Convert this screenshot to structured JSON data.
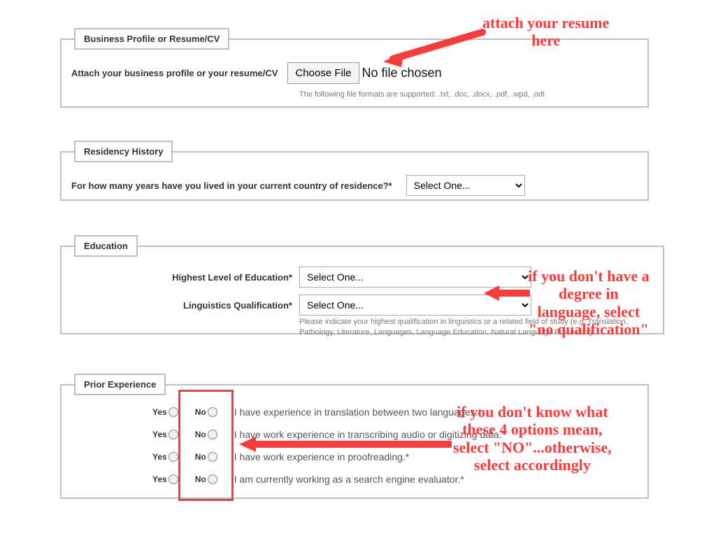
{
  "profile": {
    "legend": "Business Profile or Resume/CV",
    "label": "Attach your business profile or your resume/CV",
    "button": "Choose File",
    "nofile": "No file chosen",
    "formats": "The following file formats are supported: .txt, .doc, .docx, .pdf, .wpd, .odt"
  },
  "residency": {
    "legend": "Residency History",
    "question": "For how many years have you lived in your current country of residence?*",
    "select": "Select One..."
  },
  "education": {
    "legend": "Education",
    "highest_label": "Highest Level of Education*",
    "highest_select": "Select One...",
    "ling_label": "Linguistics Qualification*",
    "ling_select": "Select One...",
    "ling_hint": "Please indicate your highest qualification in linguistics or a related field of study (e.g. Translation,\nPathology, Literature, Languages, Language Education, Natural Language Processing"
  },
  "experience": {
    "legend": "Prior Experience",
    "yes": "Yes",
    "no": "No",
    "q1": "I have experience in translation between two languages.*",
    "q2": "I have work experience in transcribing audio or digitizing data.*",
    "q3": "I have work experience in proofreading.*",
    "q4": "I am currently working as a search engine evaluator.*"
  },
  "annotations": {
    "a1": "attach your resume\nhere",
    "a2": "if you don't have a\ndegree in\nlanguage, select\n\"no qualification\"",
    "a3": "if you don't know what\nthese 4 options mean,\nselect \"NO\"...otherwise,\nselect accordingly"
  }
}
